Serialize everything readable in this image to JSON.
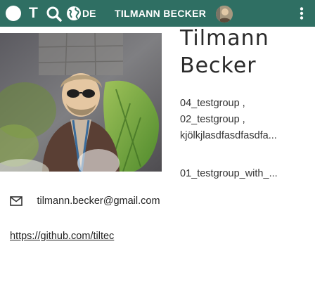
{
  "toolbar": {
    "logo_icon": "circle-logo-icon",
    "title_letter": "T",
    "search_icon": "search-icon",
    "globe_icon": "globe-icon",
    "language": "DE",
    "user_name": "TILMANN BECKER",
    "avatar_icon": "user-avatar",
    "menu_icon": "more-vertical-icon",
    "color": "#2f6f63"
  },
  "profile": {
    "photo": "profile-photo",
    "first_name": "Tilmann",
    "last_name": "Becker",
    "groups": [
      {
        "label": "04_testgroup ,"
      },
      {
        "label": "02_testgroup ,"
      },
      {
        "label": "kjölkjlasdfasdfasdfa..."
      }
    ],
    "groups_more": "01_testgroup_with_...",
    "email": "tilmann.becker@gmail.com",
    "email_icon": "mail-icon",
    "github": "https://github.com/tiltec"
  }
}
